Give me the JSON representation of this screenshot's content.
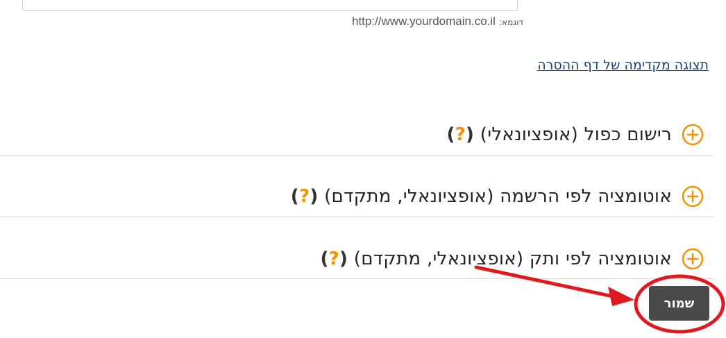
{
  "url_field": {
    "example_label": "דוגמא:",
    "example_url": "http://www.yourdomain.co.il"
  },
  "preview_link": "תצוגה מקדימה של דף ההסרה",
  "sections": [
    {
      "title": "רישום כפול (אופציונאלי)",
      "help": "?"
    },
    {
      "title": "אוטומציה לפי הרשמה (אופציונאלי, מתקדם)",
      "help": "?"
    },
    {
      "title": "אוטומציה לפי ותק (אופציונאלי, מתקדם)",
      "help": "?"
    }
  ],
  "save_label": "שמור",
  "colors": {
    "accent": "#f39200",
    "link": "#1a3f7a",
    "button_bg": "#4a4a4a",
    "annotation_red": "#e0191f"
  },
  "icons": {
    "expand": "plus-circle-icon"
  }
}
